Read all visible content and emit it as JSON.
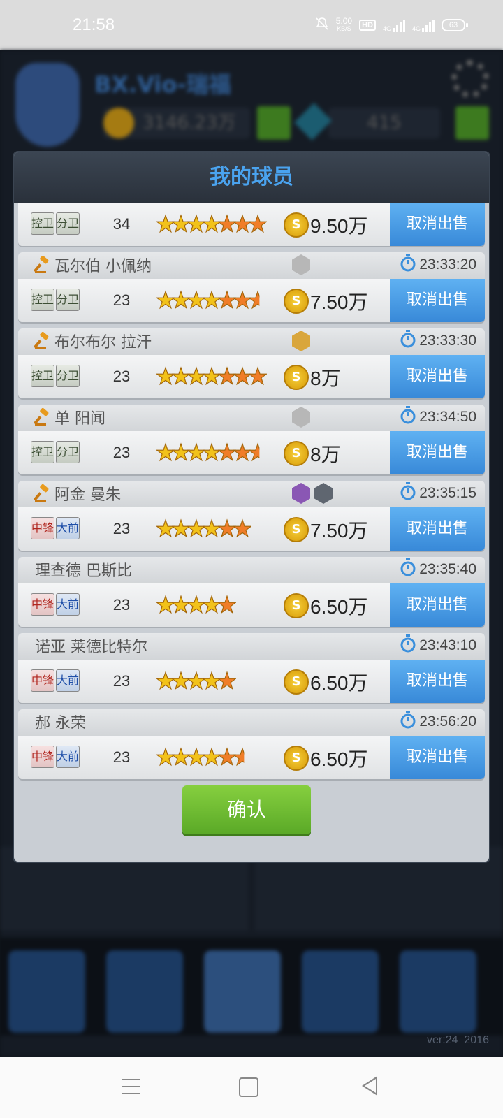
{
  "status_bar": {
    "time": "21:58",
    "net_speed": "5.00",
    "net_unit": "KB/S",
    "hd": "HD",
    "net1": "4G",
    "net2": "4G",
    "battery": "63"
  },
  "background": {
    "team_name": "BX.Vio-瑞福",
    "coins": "3146.23万",
    "gems": "415",
    "version": "ver:24_2016"
  },
  "dialog": {
    "title": "我的球员",
    "confirm_label": "确认",
    "cancel_label": "取消出售"
  },
  "players": [
    {
      "name": "",
      "pos1": "控卫",
      "pos2": "分卫",
      "pos_color": "g",
      "age": "34",
      "stars_total": 7,
      "stars_gold": 4,
      "price": "9.50万",
      "time": "",
      "auction": false,
      "badges": []
    },
    {
      "name": "瓦尔伯 小佩纳",
      "pos1": "控卫",
      "pos2": "分卫",
      "pos_color": "g",
      "age": "23",
      "stars_total": 6.5,
      "stars_gold": 4,
      "price": "7.50万",
      "time": "23:33:20",
      "auction": true,
      "badges": [
        "silver"
      ]
    },
    {
      "name": "布尔布尔 拉汗",
      "pos1": "控卫",
      "pos2": "分卫",
      "pos_color": "g",
      "age": "23",
      "stars_total": 7,
      "stars_gold": 4,
      "price": "8万",
      "time": "23:33:30",
      "auction": true,
      "badges": [
        "gold"
      ]
    },
    {
      "name": "单 阳闻",
      "pos1": "控卫",
      "pos2": "分卫",
      "pos_color": "g",
      "age": "23",
      "stars_total": 6.5,
      "stars_gold": 4,
      "price": "8万",
      "time": "23:34:50",
      "auction": true,
      "badges": [
        "silver"
      ]
    },
    {
      "name": "阿金 曼朱",
      "pos1": "中锋",
      "pos2": "大前",
      "pos_color": "rb",
      "age": "23",
      "stars_total": 6,
      "stars_gold": 4,
      "price": "7.50万",
      "time": "23:35:15",
      "auction": true,
      "badges": [
        "purple",
        "gray"
      ]
    },
    {
      "name": "理查德 巴斯比",
      "pos1": "中锋",
      "pos2": "大前",
      "pos_color": "rb",
      "age": "23",
      "stars_total": 5,
      "stars_gold": 4,
      "price": "6.50万",
      "time": "23:35:40",
      "auction": false,
      "badges": []
    },
    {
      "name": "诺亚 莱德比特尔",
      "pos1": "中锋",
      "pos2": "大前",
      "pos_color": "rb",
      "age": "23",
      "stars_total": 5,
      "stars_gold": 4,
      "price": "6.50万",
      "time": "23:43:10",
      "auction": false,
      "badges": []
    },
    {
      "name": "郝 永荣",
      "pos1": "中锋",
      "pos2": "大前",
      "pos_color": "rb",
      "age": "23",
      "stars_total": 5.5,
      "stars_gold": 4,
      "price": "6.50万",
      "time": "23:56:20",
      "auction": false,
      "badges": []
    }
  ],
  "colors": {
    "gold_star": "#f2c21a",
    "orange_star": "#f07d28",
    "accent_blue": "#3f93de",
    "confirm_green": "#6fbd30"
  }
}
